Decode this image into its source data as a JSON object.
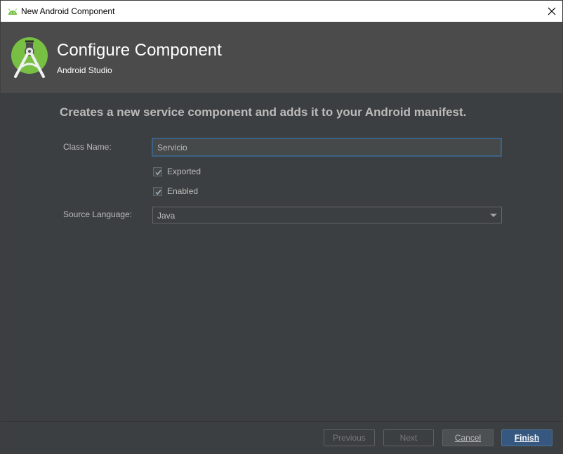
{
  "window": {
    "title": "New Android Component",
    "close_glyph": "✕"
  },
  "header": {
    "title": "Configure Component",
    "subtitle": "Android Studio"
  },
  "main": {
    "description": "Creates a new service component and adds it to your Android manifest.",
    "class_name_label": "Class Name:",
    "class_name_value": "Servicio",
    "exported_label": "Exported",
    "exported_checked": true,
    "enabled_label": "Enabled",
    "enabled_checked": true,
    "source_language_label": "Source Language:",
    "source_language_value": "Java"
  },
  "footer": {
    "previous_label": "Previous",
    "next_label": "Next",
    "cancel_label": "Cancel",
    "finish_label": "Finish"
  },
  "colors": {
    "android_green": "#77c044",
    "accent_blue": "#365880",
    "background": "#3c3f41",
    "header_bg": "#4b4b4b"
  }
}
